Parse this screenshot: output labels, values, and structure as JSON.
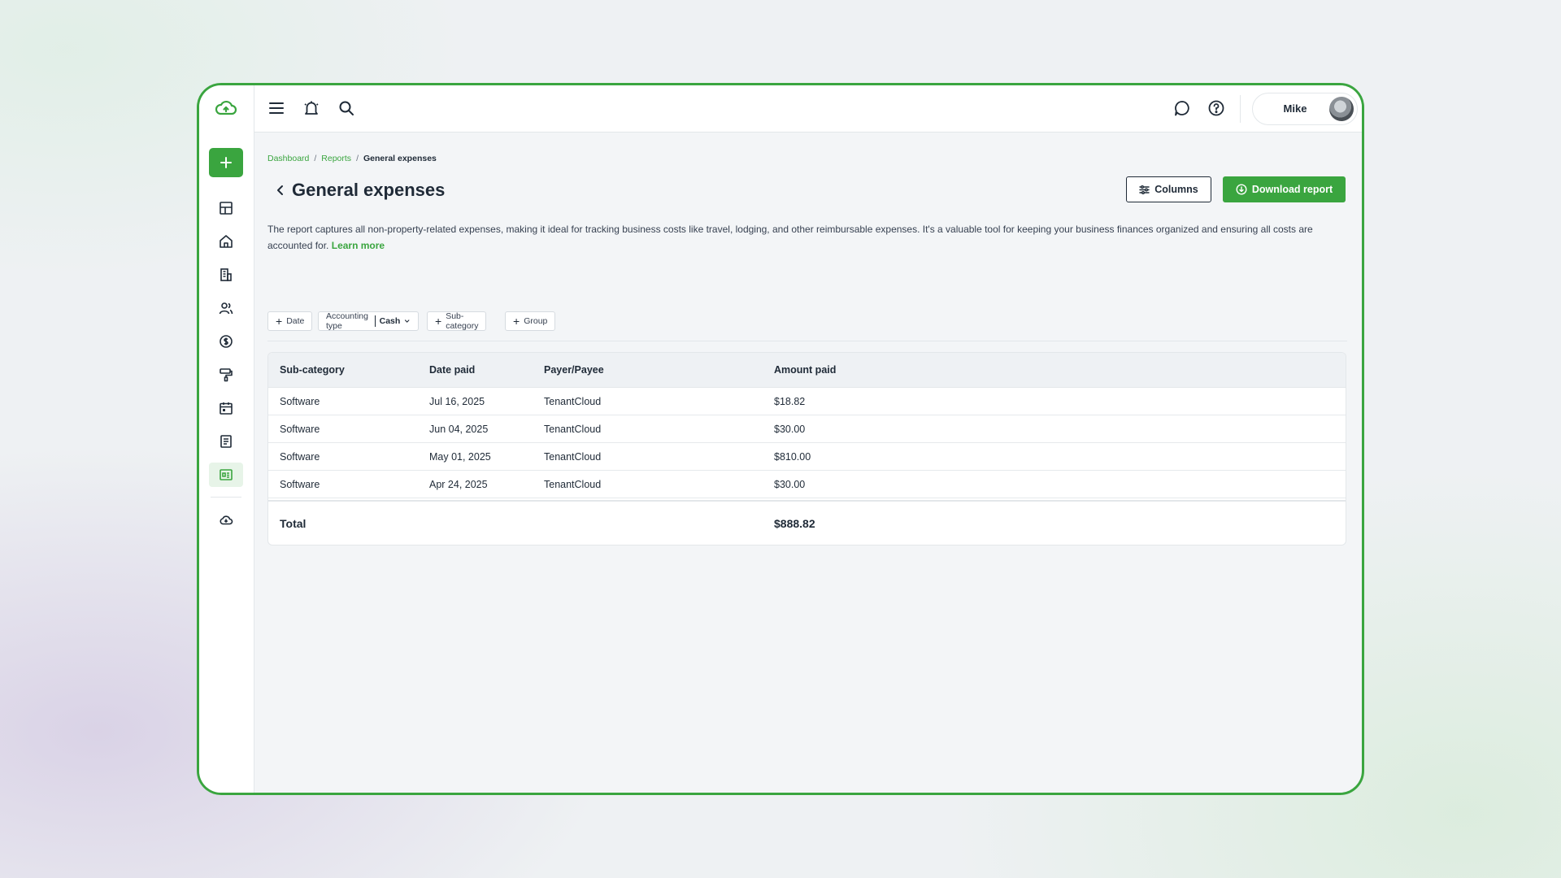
{
  "topbar": {
    "user_name": "Mike"
  },
  "sidebar": {
    "items": [
      {
        "icon": "dashboard-grid-icon"
      },
      {
        "icon": "home-icon"
      },
      {
        "icon": "building-icon"
      },
      {
        "icon": "people-icon"
      },
      {
        "icon": "dollar-icon"
      },
      {
        "icon": "paint-roller-icon"
      },
      {
        "icon": "calendar-icon"
      },
      {
        "icon": "document-icon"
      },
      {
        "icon": "reports-icon",
        "active": true
      },
      {
        "icon": "cloud-download-icon"
      }
    ]
  },
  "breadcrumb": {
    "items": [
      "Dashboard",
      "Reports"
    ],
    "current": "General expenses"
  },
  "page": {
    "title": "General expenses",
    "columns_label": "Columns",
    "download_label": "Download report",
    "description": "The report captures all non-property-related expenses, making it ideal for tracking business costs like travel, lodging, and other reimbursable expenses. It's a valuable tool for keeping your business finances organized and ensuring all costs are accounted for.",
    "learn_more": "Learn more"
  },
  "filters": {
    "date": "Date",
    "accounting_type_label": "Accounting type",
    "accounting_type_value": "Cash",
    "sub_category": "Sub-category",
    "group": "Group"
  },
  "table": {
    "headers": [
      "Sub-category",
      "Date paid",
      "Payer/Payee",
      "Amount paid"
    ],
    "rows": [
      [
        "Software",
        "Jul 16, 2025",
        "TenantCloud",
        "$18.82"
      ],
      [
        "Software",
        "Jun 04, 2025",
        "TenantCloud",
        "$30.00"
      ],
      [
        "Software",
        "May 01, 2025",
        "TenantCloud",
        "$810.00"
      ],
      [
        "Software",
        "Apr 24, 2025",
        "TenantCloud",
        "$30.00"
      ]
    ],
    "total_label": "Total",
    "total_value": "$888.82"
  },
  "colors": {
    "accent": "#3aa53f",
    "text": "#1f2a37",
    "background": "#f3f5f7"
  }
}
